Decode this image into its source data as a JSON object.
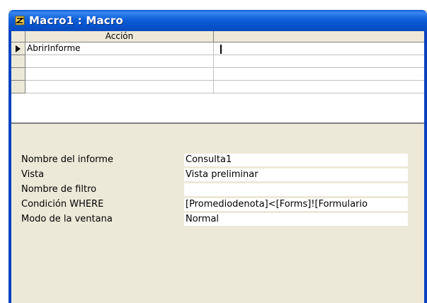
{
  "window": {
    "title": "Macro1 : Macro"
  },
  "grid": {
    "column_header": "Acción",
    "rows": [
      {
        "action": "AbrirInforme",
        "selected": true
      },
      {
        "action": ""
      },
      {
        "action": ""
      },
      {
        "action": ""
      }
    ]
  },
  "properties": {
    "items": [
      {
        "label": "Nombre del informe",
        "value": "Consulta1"
      },
      {
        "label": "Vista",
        "value": "Vista preliminar"
      },
      {
        "label": "Nombre de filtro",
        "value": ""
      },
      {
        "label": "Condición WHERE",
        "value": "[Promediodenota]<[Forms]![Formulario"
      },
      {
        "label": "Modo de la ventana",
        "value": "Normal"
      }
    ]
  },
  "colors": {
    "titlebar": "#0a5ad4",
    "frame": "#0842c0",
    "panel": "#ece9d8"
  }
}
